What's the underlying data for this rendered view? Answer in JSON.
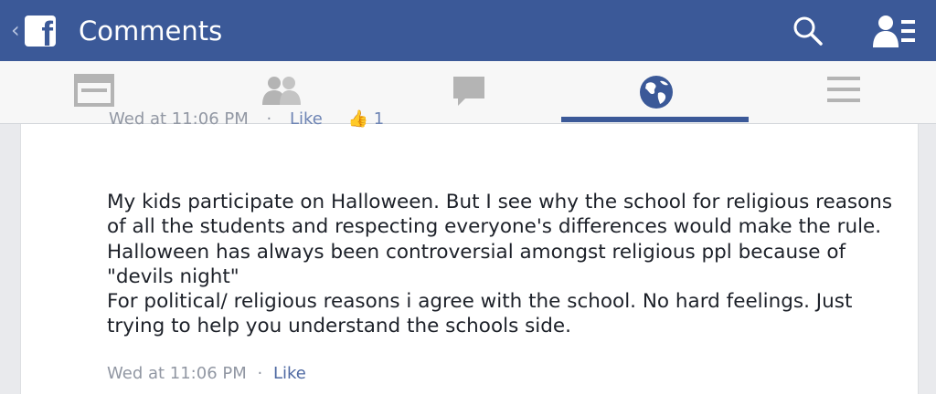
{
  "header": {
    "logo_letter": "f",
    "title": "Comments"
  },
  "tabs": [
    {
      "name": "news-feed",
      "icon": "news-feed-icon",
      "active": false
    },
    {
      "name": "friend-requests",
      "icon": "friends-icon",
      "active": false
    },
    {
      "name": "messages",
      "icon": "chat-bubble-icon",
      "active": false
    },
    {
      "name": "notifications",
      "icon": "globe-icon",
      "active": true
    },
    {
      "name": "more",
      "icon": "menu-icon",
      "active": false
    }
  ],
  "previous_comment": {
    "timestamp": "Wed at 11:06 PM",
    "like_label": "Like",
    "like_count": "1"
  },
  "comment": {
    "text": "My kids participate on Halloween. But I see why the school for religious reasons of all the students and respecting everyone's differences would make the rule. Halloween has always been controversial amongst religious ppl because of \"devils night\"\nFor political/ religious reasons i agree with the school. No hard feelings. Just trying to help you understand the schools side.",
    "timestamp": "Wed at 11:06 PM",
    "separator": "·",
    "like_label": "Like"
  },
  "colors": {
    "brand": "#3b5998",
    "tab_icon": "#b4b4b4",
    "active_tab_icon": "#3b5998"
  }
}
